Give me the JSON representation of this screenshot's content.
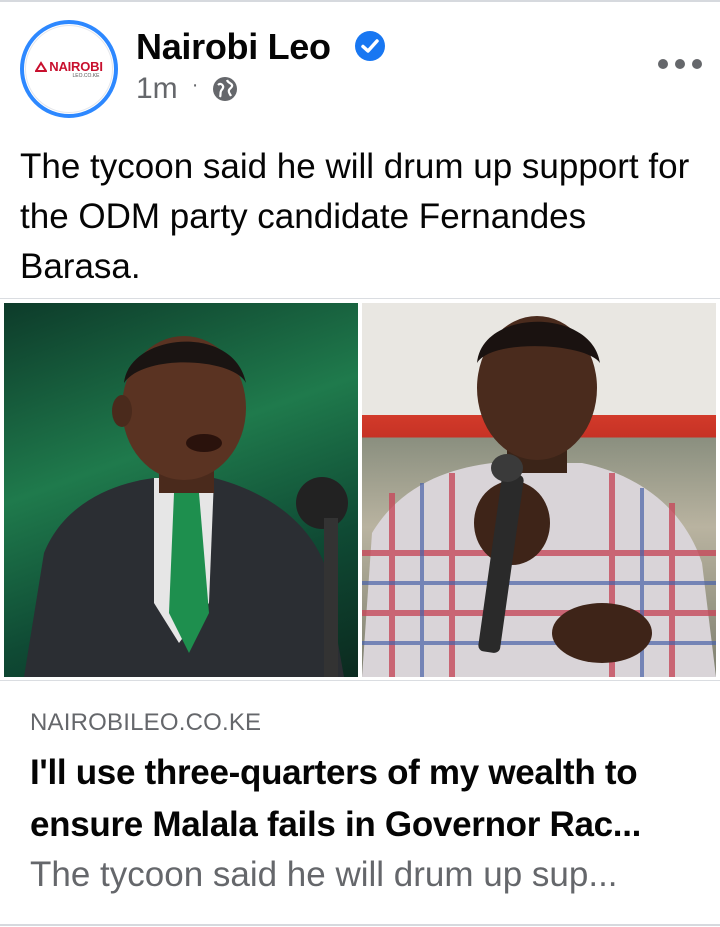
{
  "post": {
    "page_name": "Nairobi Leo",
    "verified": true,
    "timestamp": "1m",
    "separator": "·",
    "audience_icon": "globe-icon",
    "more_icon": "more-options-icon",
    "caption": "The tycoon said he will drum up support for the ODM party candidate Fernandes Barasa."
  },
  "avatar": {
    "logo_text": "NAIROBI",
    "logo_sub": "LEO.CO.KE",
    "brand_color": "#c8102e",
    "ring_color": "#2d88ff"
  },
  "link_preview": {
    "domain": "NAIROBILEO.CO.KE",
    "headline": "I'll use three-quarters of my wealth to ensure Malala fails in Governor Rac...",
    "description": "The tycoon said he will drum up sup..."
  },
  "colors": {
    "verified_blue": "#1877f2",
    "secondary_text": "#65676b"
  }
}
